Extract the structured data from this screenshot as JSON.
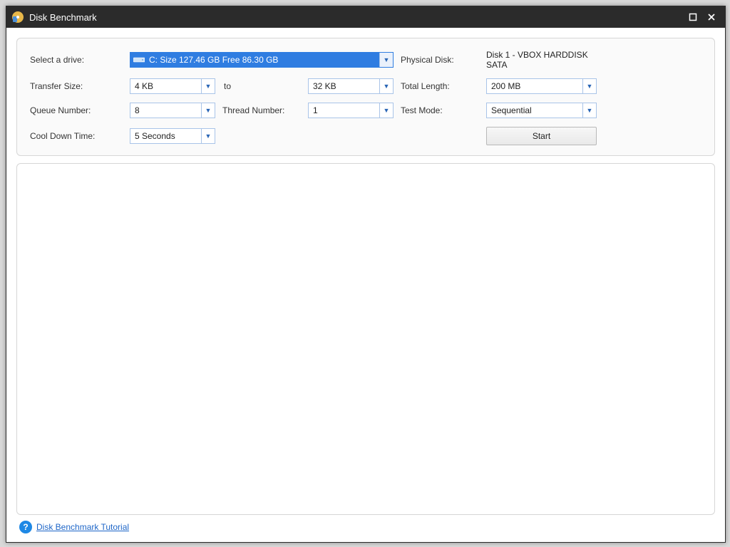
{
  "titlebar": {
    "title": "Disk Benchmark"
  },
  "form": {
    "select_drive_label": "Select a drive:",
    "drive_value": "C:  Size 127.46 GB  Free 86.30 GB",
    "physical_disk_label": "Physical Disk:",
    "physical_disk_value": "Disk 1 - VBOX HARDDISK SATA",
    "transfer_size_label": "Transfer Size:",
    "transfer_size_from": "4 KB",
    "to_label": "to",
    "transfer_size_to": "32 KB",
    "total_length_label": "Total Length:",
    "total_length_value": "200 MB",
    "queue_number_label": "Queue Number:",
    "queue_number_value": "8",
    "thread_number_label": "Thread Number:",
    "thread_number_value": "1",
    "test_mode_label": "Test Mode:",
    "test_mode_value": "Sequential",
    "cool_down_label": "Cool Down Time:",
    "cool_down_value": "5 Seconds",
    "start_button": "Start"
  },
  "footer": {
    "tutorial_link": "Disk Benchmark Tutorial"
  }
}
